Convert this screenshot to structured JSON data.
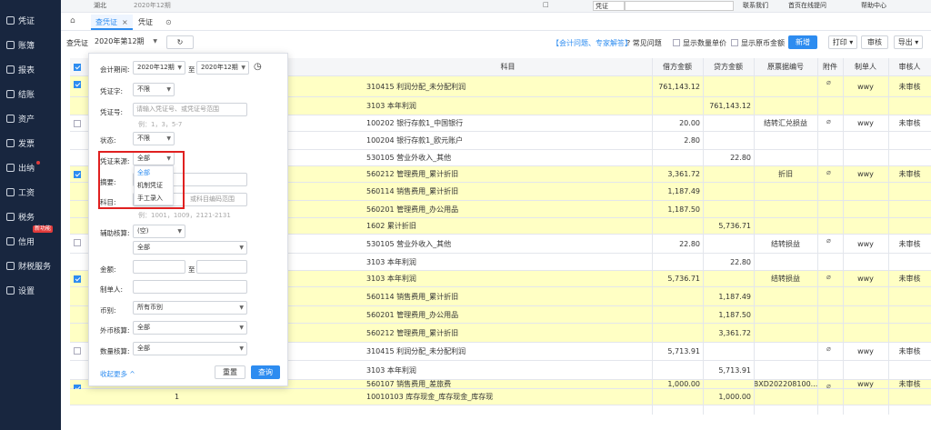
{
  "sidebar": {
    "items": [
      {
        "label": "凭证",
        "icon": "voucher-icon"
      },
      {
        "label": "账簿",
        "icon": "ledger-icon"
      },
      {
        "label": "报表",
        "icon": "report-icon"
      },
      {
        "label": "结账",
        "icon": "closing-icon"
      },
      {
        "label": "资产",
        "icon": "asset-icon"
      },
      {
        "label": "发票",
        "icon": "invoice-icon"
      },
      {
        "label": "出纳",
        "icon": "cashier-icon"
      },
      {
        "label": "工资",
        "icon": "salary-icon"
      },
      {
        "label": "税务",
        "icon": "tax-icon"
      },
      {
        "label": "信用",
        "icon": "credit-icon"
      },
      {
        "label": "财税服务",
        "icon": "service-icon"
      },
      {
        "label": "设置",
        "icon": "settings-icon"
      }
    ],
    "badge": "新功能"
  },
  "topbar": {
    "company": "湖北",
    "period": "2020年12期",
    "search_scope": "凭证",
    "links": [
      "联系我们",
      "首页在线提问",
      "帮助中心"
    ]
  },
  "tabs": [
    {
      "label": "查凭证",
      "active": true
    },
    {
      "label": "凭证",
      "active": false
    }
  ],
  "toolbar": {
    "label": "查凭证",
    "period": "2020年第12期",
    "help_link": "【会计问题、专家解答】",
    "faq": "常见问题",
    "show_qty": "显示数量单价",
    "show_fx": "显示原币金额",
    "new": "新增",
    "print": "打印",
    "review": "审核",
    "export": "导出"
  },
  "table": {
    "headers": [
      "科目",
      "借方金额",
      "贷方金额",
      "原票据编号",
      "附件",
      "制单人",
      "审核人"
    ],
    "rows": [
      {
        "subject": "310415 利润分配_未分配利润",
        "debit": "761,143.12",
        "credit": "",
        "doc": "",
        "maker": "wwy",
        "status": "未审核",
        "clip": true,
        "hl": true
      },
      {
        "subject": "3103 本年利润",
        "debit": "",
        "credit": "761,143.12",
        "doc": "",
        "maker": "",
        "status": "",
        "clip": false,
        "hl": true
      },
      {
        "subject": "100202 银行存款1_中国银行",
        "debit": "20.00",
        "credit": "",
        "doc": "结转汇兑损益",
        "maker": "wwy",
        "status": "未审核",
        "clip": true,
        "hl": false
      },
      {
        "subject": "100204 银行存款1_欧元账户",
        "debit": "2.80",
        "credit": "",
        "doc": "",
        "maker": "",
        "status": "",
        "clip": false,
        "hl": false
      },
      {
        "subject": "530105 营业外收入_其他",
        "debit": "",
        "credit": "22.80",
        "doc": "",
        "maker": "",
        "status": "",
        "clip": false,
        "hl": false
      },
      {
        "subject": "560212 管理费用_累计折旧",
        "debit": "3,361.72",
        "credit": "",
        "doc": "折旧",
        "maker": "wwy",
        "status": "未审核",
        "clip": true,
        "hl": true
      },
      {
        "subject": "560114 销售费用_累计折旧",
        "debit": "1,187.49",
        "credit": "",
        "doc": "",
        "maker": "",
        "status": "",
        "clip": false,
        "hl": true
      },
      {
        "subject": "560201 管理费用_办公用品",
        "debit": "1,187.50",
        "credit": "",
        "doc": "",
        "maker": "",
        "status": "",
        "clip": false,
        "hl": true
      },
      {
        "subject": "1602 累计折旧",
        "debit": "",
        "credit": "5,736.71",
        "doc": "",
        "maker": "",
        "status": "",
        "clip": false,
        "hl": true
      },
      {
        "subject": "530105 营业外收入_其他",
        "debit": "22.80",
        "credit": "",
        "doc": "结转损益",
        "maker": "wwy",
        "status": "未审核",
        "clip": true,
        "hl": false
      },
      {
        "subject": "3103 本年利润",
        "debit": "",
        "credit": "22.80",
        "doc": "",
        "maker": "",
        "status": "",
        "clip": false,
        "hl": false
      },
      {
        "subject": "3103 本年利润",
        "debit": "5,736.71",
        "credit": "",
        "doc": "结转损益",
        "maker": "wwy",
        "status": "未审核",
        "clip": true,
        "hl": true
      },
      {
        "subject": "560114 销售费用_累计折旧",
        "debit": "",
        "credit": "1,187.49",
        "doc": "",
        "maker": "",
        "status": "",
        "clip": false,
        "hl": true
      },
      {
        "subject": "560201 管理费用_办公用品",
        "debit": "",
        "credit": "1,187.50",
        "doc": "",
        "maker": "",
        "status": "",
        "clip": false,
        "hl": true
      },
      {
        "subject": "560212 管理费用_累计折旧",
        "debit": "",
        "credit": "3,361.72",
        "doc": "",
        "maker": "",
        "status": "",
        "clip": false,
        "hl": true
      },
      {
        "subject": "310415 利润分配_未分配利润",
        "debit": "5,713.91",
        "credit": "",
        "doc": "",
        "maker": "wwy",
        "status": "未审核",
        "clip": true,
        "hl": false
      },
      {
        "subject": "3103 本年利润",
        "debit": "",
        "credit": "5,713.91",
        "doc": "",
        "maker": "",
        "status": "",
        "clip": false,
        "hl": false
      },
      {
        "subject": "560107 销售费用_差旅费",
        "debit": "1,000.00",
        "credit": "",
        "doc": "BXD202208100...",
        "maker": "wwy",
        "status": "未审核",
        "clip": true,
        "hl": true
      },
      {
        "subject": "10010103 库存现金_库存现金_库存现",
        "debit": "",
        "credit": "1,000.00",
        "doc": "",
        "maker": "",
        "status": "",
        "clip": false,
        "hl": true
      }
    ],
    "last_row_index": "1"
  },
  "panel": {
    "period_label": "会计期间:",
    "period_from": "2020年12期",
    "period_to_sep": "至",
    "period_to": "2020年12期",
    "word_label": "凭证字:",
    "word_value": "不限",
    "num_label": "凭证号:",
    "num_placeholder": "请输入凭证号、或凭证号范围",
    "num_hint": "例：1，3，5-7",
    "state_label": "状态:",
    "state_value": "不限",
    "source_label": "凭证来源:",
    "source_value": "全部",
    "summary_label": "摘要:",
    "subject_label": "科目:",
    "subject_placeholder": "或科目编码范围",
    "subject_hint": "例：1001，1009，2121-2131",
    "aux_label": "辅助核算:",
    "aux_value": "(空)",
    "aux_value2": "全部",
    "amount_label": "金额:",
    "amount_sep": "至",
    "maker_label": "制单人:",
    "currency_label": "币别:",
    "currency_value": "所有币别",
    "fx_label": "外币核算:",
    "fx_value": "全部",
    "qty_label": "数量核算:",
    "qty_value": "全部",
    "collapse": "收起更多",
    "reset": "重置",
    "search": "查询"
  },
  "dropdown": {
    "options": [
      "全部",
      "机制凭证",
      "手工录入"
    ]
  }
}
